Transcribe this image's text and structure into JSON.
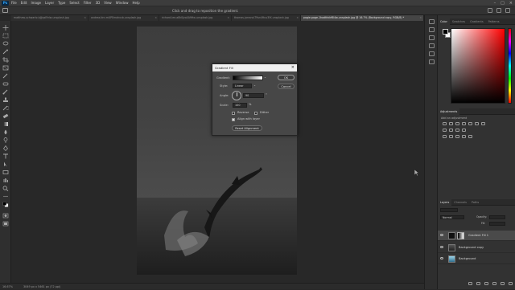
{
  "app": {
    "logo": "Ps"
  },
  "menu": [
    "File",
    "Edit",
    "Image",
    "Layer",
    "Type",
    "Select",
    "Filter",
    "3D",
    "View",
    "Window",
    "Help"
  ],
  "window_controls": [
    "–",
    "□",
    "×"
  ],
  "options_bar": {
    "hint": "Click and drag to reposition the gradient."
  },
  "tabs": [
    {
      "label": "matthew-schwartz-bJjJqxlFelw-unsplash.jpg"
    },
    {
      "label": "andrea-tinr-mUPEmohvcb-unsplash.jpg"
    },
    {
      "label": "richard-lee-a8k0jzo4A9Hw-unsplash.jpg"
    },
    {
      "label": "thomas-jarrand-T9sn4ftuv3fX-unsplash.jpg"
    },
    {
      "label": "pagie-page-1hadthkkf6l4w-unsplash.jpg @ 16.7% (Background copy, RGB/8) *",
      "active": true
    }
  ],
  "status": {
    "zoom": "16.67%",
    "doc": "3049 px x 5461 px (72 ppi)"
  },
  "color_panel": {
    "tabs": [
      "Color",
      "Swatches",
      "Gradients",
      "Patterns"
    ],
    "foreground": "#000000",
    "background": "#ffffff"
  },
  "adjustments_panel": {
    "title": "Adjustments",
    "subtitle": "Add an adjustment"
  },
  "layers_panel": {
    "tabs": [
      "Layers",
      "Channels",
      "Paths"
    ],
    "blend_mode": "Normal",
    "opacity_label": "Opacity:",
    "fill_label": "Fill:",
    "layers": [
      {
        "name": "Gradient Fill 1",
        "selected": true
      },
      {
        "name": "Background copy",
        "selected": false
      },
      {
        "name": "Background",
        "selected": false
      }
    ]
  },
  "dialog": {
    "title": "Gradient Fill",
    "gradient_label": "Gradient:",
    "style_label": "Style:",
    "style_value": "Linear",
    "angle_label": "Angle:",
    "angle_value": "90",
    "angle_unit": "°",
    "scale_label": "Scale:",
    "scale_value": "100",
    "scale_unit": "%",
    "reverse_label": "Reverse",
    "dither_label": "Dither",
    "align_label": "Align with layer",
    "reset_label": "Reset Alignment",
    "ok_label": "OK",
    "cancel_label": "Cancel"
  }
}
